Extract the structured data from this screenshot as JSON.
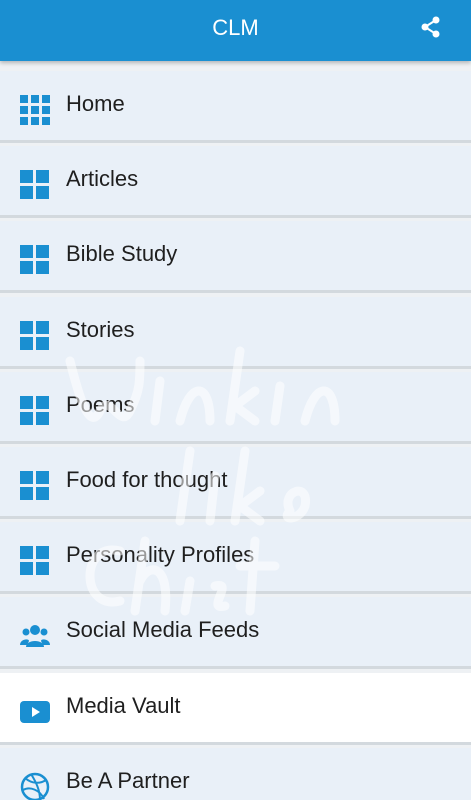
{
  "app": {
    "title": "CLM",
    "accent": "#1a8fd1",
    "share_icon": "share-icon"
  },
  "menu": {
    "items": [
      {
        "label": "Home",
        "icon": "grid-dots-icon"
      },
      {
        "label": "Articles",
        "icon": "tiles-icon"
      },
      {
        "label": "Bible Study",
        "icon": "tiles-icon"
      },
      {
        "label": "Stories",
        "icon": "tiles-icon"
      },
      {
        "label": "Poems",
        "icon": "tiles-icon"
      },
      {
        "label": "Food for thought",
        "icon": "tiles-icon"
      },
      {
        "label": "Personality Profiles",
        "icon": "tiles-icon"
      },
      {
        "label": "Social Media Feeds",
        "icon": "users-icon"
      },
      {
        "label": "Media Vault",
        "icon": "play-icon"
      },
      {
        "label": "Be A Partner",
        "icon": "ball-icon"
      }
    ]
  }
}
